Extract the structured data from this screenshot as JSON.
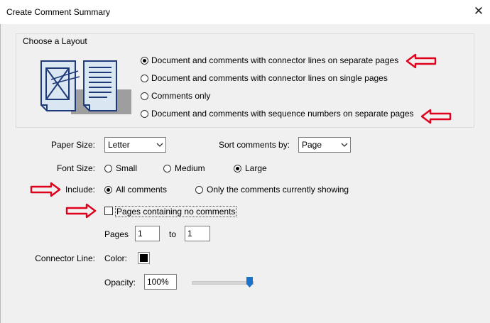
{
  "window": {
    "title": "Create Comment Summary",
    "close_glyph": "✕"
  },
  "layout_group": {
    "legend": "Choose a Layout",
    "options": [
      {
        "label": "Document and comments with connector lines on separate pages",
        "selected": true
      },
      {
        "label": "Document and comments with connector lines on single pages",
        "selected": false
      },
      {
        "label": "Comments only",
        "selected": false
      },
      {
        "label": "Document and comments with sequence numbers on separate pages",
        "selected": false
      }
    ]
  },
  "paper_size": {
    "label": "Paper Size:",
    "value": "Letter"
  },
  "sort_by": {
    "label": "Sort comments by:",
    "value": "Page"
  },
  "font_size": {
    "label": "Font Size:",
    "options": [
      {
        "label": "Small",
        "selected": false
      },
      {
        "label": "Medium",
        "selected": false
      },
      {
        "label": "Large",
        "selected": true
      }
    ]
  },
  "include": {
    "label": "Include:",
    "options": [
      {
        "label": "All comments",
        "selected": true
      },
      {
        "label": "Only the comments currently showing",
        "selected": false
      }
    ]
  },
  "pages_no_comments": {
    "label": "Pages containing no comments",
    "checked": false
  },
  "pages_range": {
    "label": "Pages",
    "from": "1",
    "to_label": "to",
    "to": "1"
  },
  "connector": {
    "label": "Connector Line:",
    "color_label": "Color:",
    "color": "#000000",
    "opacity_label": "Opacity:",
    "opacity_value": "100%",
    "opacity_fraction": 1.0
  },
  "colors": {
    "annotation_arrow": "#e0001b",
    "slider_thumb": "#1a73c8"
  }
}
